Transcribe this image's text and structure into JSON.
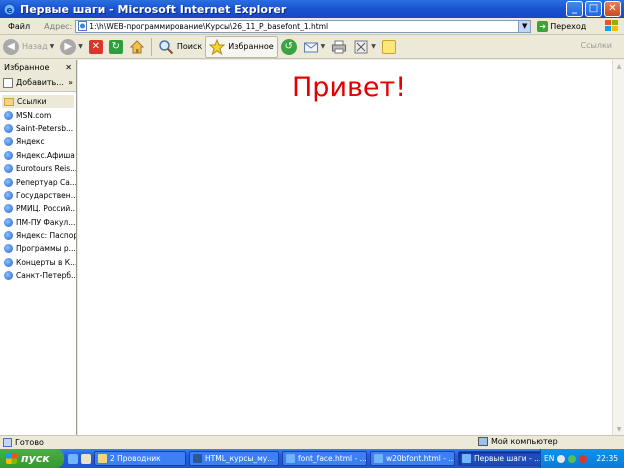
{
  "window": {
    "title": "Первые шаги - Microsoft Internet Explorer",
    "buttons": {
      "minimize": "_",
      "maximize": "□",
      "close": "✕"
    }
  },
  "menu": {
    "file": "Файл"
  },
  "address": {
    "label": "Адрес:",
    "url": "1:\\h\\WEB-программирование\\Курсы\\26_11_P_basefont_1.html",
    "go_label": "Переход"
  },
  "toolbar": {
    "back": "Назад",
    "search": "Поиск",
    "favorites": "Избранное",
    "links": "Ссылки"
  },
  "favorites": {
    "header": "Избранное",
    "add": "Добавить...",
    "items": [
      {
        "label": "Ссылки",
        "type": "folder"
      },
      {
        "label": "MSN.com",
        "type": "link"
      },
      {
        "label": "Saint-Petersb...",
        "type": "link"
      },
      {
        "label": "Яндекс",
        "type": "link"
      },
      {
        "label": "Яндекс.Афиша",
        "type": "link"
      },
      {
        "label": "Eurotours Reis...",
        "type": "link"
      },
      {
        "label": "Репертуар Са...",
        "type": "link"
      },
      {
        "label": "Государствен...",
        "type": "link"
      },
      {
        "label": "РМИЦ. Россий...",
        "type": "link"
      },
      {
        "label": "ПМ-ПУ  Факул...",
        "type": "link"
      },
      {
        "label": "Яндекс: Паспорт",
        "type": "link"
      },
      {
        "label": "Программы р...",
        "type": "link"
      },
      {
        "label": "Концерты в К...",
        "type": "link"
      },
      {
        "label": "Санкт-Петерб...",
        "type": "link"
      }
    ]
  },
  "page": {
    "heading": "Привет!",
    "heading_color": "#E50000"
  },
  "status": {
    "text": "Готово",
    "zone": "Мой компьютер"
  },
  "taskbar": {
    "start": "пуск",
    "tasks": [
      {
        "label": "2 Проводник",
        "active": false
      },
      {
        "label": "HTML_курсы_му...",
        "active": false
      },
      {
        "label": "font_face.html - ...",
        "active": false
      },
      {
        "label": "w20bfont.html - ...",
        "active": false
      },
      {
        "label": "Первые шаги - ...",
        "active": true
      }
    ],
    "lang": "EN",
    "clock": "22:35"
  }
}
